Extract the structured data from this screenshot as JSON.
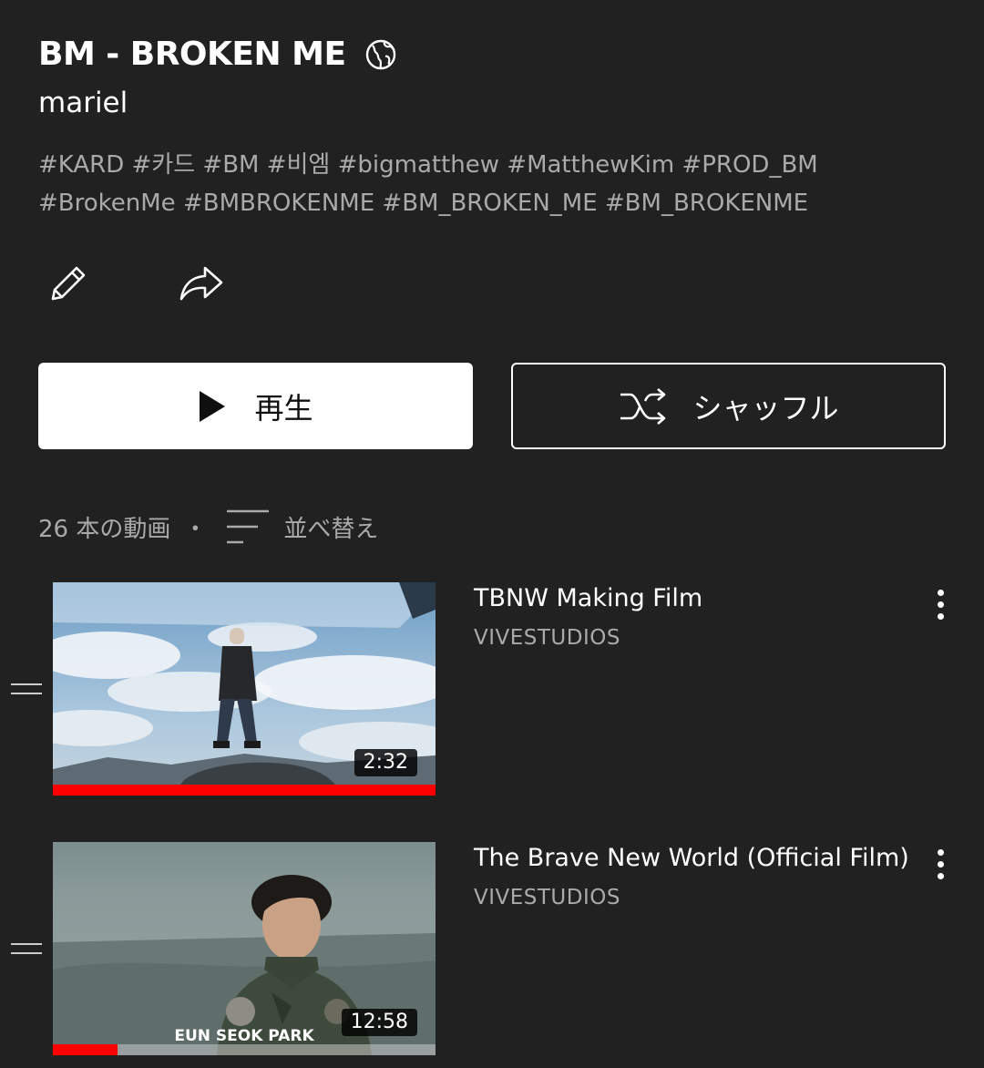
{
  "playlist": {
    "title": "BM - BROKEN ME",
    "visibility_icon": "globe-icon",
    "owner": "mariel",
    "description_line1": "#KARD #카드 #BM #비엠 #bigmatthew #MatthewKim #PROD_BM",
    "description_line2": "#BrokenMe #BMBROKENME #BM_BROKEN_ME #BM_BROKENME"
  },
  "actions": {
    "edit_icon": "pencil-icon",
    "share_icon": "share-icon",
    "play_label": "再生",
    "shuffle_label": "シャッフル"
  },
  "list_meta": {
    "count": "26 本の動画",
    "separator": "・",
    "sort_label": "並べ替え"
  },
  "videos": [
    {
      "title": "TBNW Making Film",
      "channel": "VIVESTUDIOS",
      "duration": "2:32",
      "watched_fraction": 1.0
    },
    {
      "title": "The Brave New World (Official Film)",
      "channel": "VIVESTUDIOS",
      "duration": "12:58",
      "watched_fraction": 0.17,
      "thumbnail_caption": "EUN SEOK PARK"
    }
  ],
  "colors": {
    "background": "#212121",
    "secondary_text": "#aaaaaa",
    "progress": "#ff0000"
  }
}
